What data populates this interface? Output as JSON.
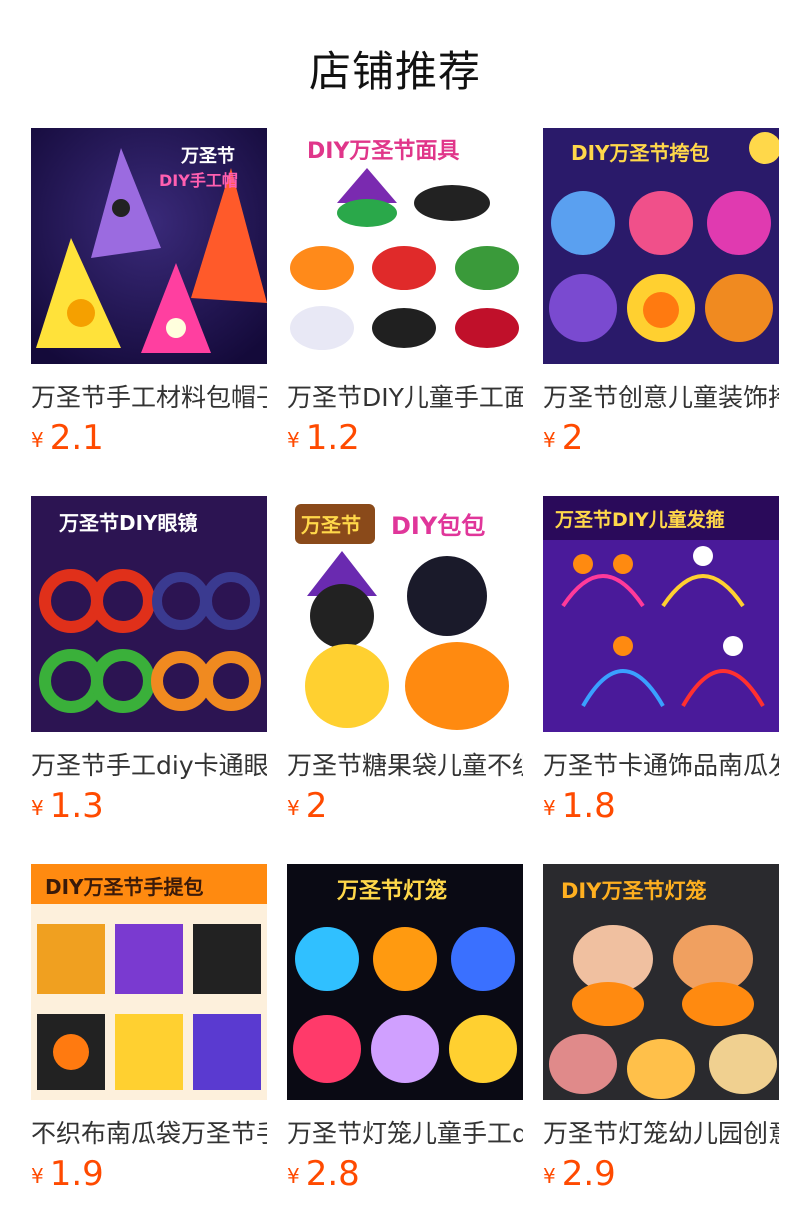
{
  "title": "店铺推荐",
  "currency": "¥",
  "products": [
    {
      "name": "万圣节手工材料包帽子",
      "price": "2.1",
      "banner": "万圣节\nDIY手工帽"
    },
    {
      "name": "万圣节DIY儿童手工面具",
      "price": "1.2",
      "banner": "DIY万圣节面具"
    },
    {
      "name": "万圣节创意儿童装饰挎包",
      "price": "2",
      "banner": "DIY万圣节挎包"
    },
    {
      "name": "万圣节手工diy卡通眼镜",
      "price": "1.3",
      "banner": "万圣节DIY眼镜"
    },
    {
      "name": "万圣节糖果袋儿童不织布",
      "price": "2",
      "banner": "万圣节 DIY包包"
    },
    {
      "name": "万圣节卡通饰品南瓜发箍",
      "price": "1.8",
      "banner": "万圣节DIY儿童发箍"
    },
    {
      "name": "不织布南瓜袋万圣节手提包",
      "price": "1.9",
      "banner": "DIY万圣节手提包"
    },
    {
      "name": "万圣节灯笼儿童手工diy",
      "price": "2.8",
      "banner": "万圣节灯笼"
    },
    {
      "name": "万圣节灯笼幼儿园创意",
      "price": "2.9",
      "banner": "DIY万圣节灯笼"
    }
  ]
}
